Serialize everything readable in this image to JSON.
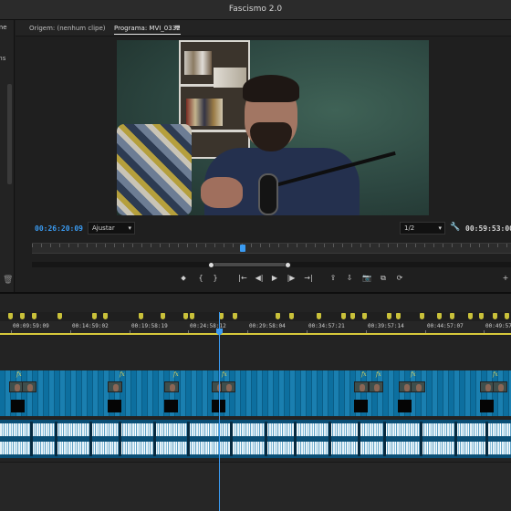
{
  "window": {
    "title": "Fascismo 2.0"
  },
  "left_panel": {
    "tab_fragment": "nme",
    "label_fragment": "ens"
  },
  "monitor": {
    "source_tab": "Origem: (nenhum clipe)",
    "program_tab": "Programa: MVI_0332",
    "tab_menu": "≡",
    "timecode_current": "00:26:20:09",
    "fit_select": "Ajustar",
    "resolution_select": "1/2",
    "timecode_duration": "00:59:53:00",
    "playhead_progress": 0.44,
    "transport": [
      "⬥",
      "{",
      "}",
      "|←",
      "◀|",
      "▶",
      "|▶",
      "→|",
      "⇪",
      "⇩",
      "📷",
      "⧉",
      "⟳",
      "+"
    ]
  },
  "timeline": {
    "time_labels": [
      "00:09:59:09",
      "00:14:59:02",
      "00:19:58:19",
      "00:24:58:12",
      "00:29:58:04",
      "00:34:57:21",
      "00:39:57:14",
      "00:44:57:07",
      "00:49:57"
    ],
    "fx_label": "fx",
    "colors": {
      "playhead": "#3a9bf2",
      "video_clip": "#0d6f9f",
      "audio_clip": "#0a4f76",
      "marker": "#c9c13a"
    }
  }
}
